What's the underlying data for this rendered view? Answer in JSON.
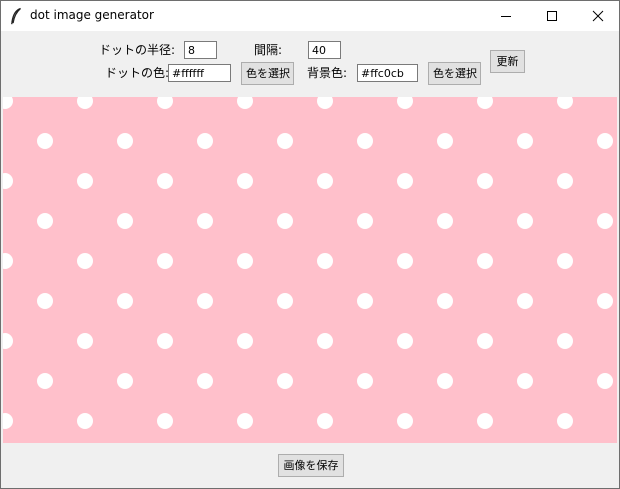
{
  "window": {
    "title": "dot image generator",
    "icon": "feather-icon",
    "controls": [
      "minimize-icon",
      "maximize-icon",
      "close-icon"
    ]
  },
  "controls": {
    "radius_label": "ドットの半径:",
    "radius_value": "8",
    "spacing_label": "間隔:",
    "spacing_value": "40",
    "dot_color_label": "ドットの色:",
    "dot_color_value": "#ffffff",
    "dot_color_button": "色を選択",
    "bg_color_label": "背景色:",
    "bg_color_value": "#ffc0cb",
    "bg_color_button": "色を選択",
    "update_button": "更新"
  },
  "canvas": {
    "dot_radius": 8,
    "dot_spacing": 40,
    "dot_color": "#ffffff",
    "background_color": "#ffc0cb"
  },
  "footer": {
    "save_button": "画像を保存"
  }
}
